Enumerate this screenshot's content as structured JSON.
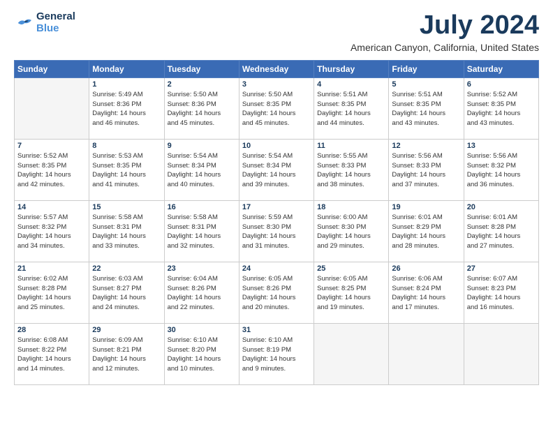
{
  "header": {
    "logo_line1": "General",
    "logo_line2": "Blue",
    "main_title": "July 2024",
    "subtitle": "American Canyon, California, United States"
  },
  "calendar": {
    "days_of_week": [
      "Sunday",
      "Monday",
      "Tuesday",
      "Wednesday",
      "Thursday",
      "Friday",
      "Saturday"
    ],
    "weeks": [
      [
        {
          "day": "",
          "info": ""
        },
        {
          "day": "1",
          "info": "Sunrise: 5:49 AM\nSunset: 8:36 PM\nDaylight: 14 hours\nand 46 minutes."
        },
        {
          "day": "2",
          "info": "Sunrise: 5:50 AM\nSunset: 8:36 PM\nDaylight: 14 hours\nand 45 minutes."
        },
        {
          "day": "3",
          "info": "Sunrise: 5:50 AM\nSunset: 8:35 PM\nDaylight: 14 hours\nand 45 minutes."
        },
        {
          "day": "4",
          "info": "Sunrise: 5:51 AM\nSunset: 8:35 PM\nDaylight: 14 hours\nand 44 minutes."
        },
        {
          "day": "5",
          "info": "Sunrise: 5:51 AM\nSunset: 8:35 PM\nDaylight: 14 hours\nand 43 minutes."
        },
        {
          "day": "6",
          "info": "Sunrise: 5:52 AM\nSunset: 8:35 PM\nDaylight: 14 hours\nand 43 minutes."
        }
      ],
      [
        {
          "day": "7",
          "info": "Sunrise: 5:52 AM\nSunset: 8:35 PM\nDaylight: 14 hours\nand 42 minutes."
        },
        {
          "day": "8",
          "info": "Sunrise: 5:53 AM\nSunset: 8:35 PM\nDaylight: 14 hours\nand 41 minutes."
        },
        {
          "day": "9",
          "info": "Sunrise: 5:54 AM\nSunset: 8:34 PM\nDaylight: 14 hours\nand 40 minutes."
        },
        {
          "day": "10",
          "info": "Sunrise: 5:54 AM\nSunset: 8:34 PM\nDaylight: 14 hours\nand 39 minutes."
        },
        {
          "day": "11",
          "info": "Sunrise: 5:55 AM\nSunset: 8:33 PM\nDaylight: 14 hours\nand 38 minutes."
        },
        {
          "day": "12",
          "info": "Sunrise: 5:56 AM\nSunset: 8:33 PM\nDaylight: 14 hours\nand 37 minutes."
        },
        {
          "day": "13",
          "info": "Sunrise: 5:56 AM\nSunset: 8:32 PM\nDaylight: 14 hours\nand 36 minutes."
        }
      ],
      [
        {
          "day": "14",
          "info": "Sunrise: 5:57 AM\nSunset: 8:32 PM\nDaylight: 14 hours\nand 34 minutes."
        },
        {
          "day": "15",
          "info": "Sunrise: 5:58 AM\nSunset: 8:31 PM\nDaylight: 14 hours\nand 33 minutes."
        },
        {
          "day": "16",
          "info": "Sunrise: 5:58 AM\nSunset: 8:31 PM\nDaylight: 14 hours\nand 32 minutes."
        },
        {
          "day": "17",
          "info": "Sunrise: 5:59 AM\nSunset: 8:30 PM\nDaylight: 14 hours\nand 31 minutes."
        },
        {
          "day": "18",
          "info": "Sunrise: 6:00 AM\nSunset: 8:30 PM\nDaylight: 14 hours\nand 29 minutes."
        },
        {
          "day": "19",
          "info": "Sunrise: 6:01 AM\nSunset: 8:29 PM\nDaylight: 14 hours\nand 28 minutes."
        },
        {
          "day": "20",
          "info": "Sunrise: 6:01 AM\nSunset: 8:28 PM\nDaylight: 14 hours\nand 27 minutes."
        }
      ],
      [
        {
          "day": "21",
          "info": "Sunrise: 6:02 AM\nSunset: 8:28 PM\nDaylight: 14 hours\nand 25 minutes."
        },
        {
          "day": "22",
          "info": "Sunrise: 6:03 AM\nSunset: 8:27 PM\nDaylight: 14 hours\nand 24 minutes."
        },
        {
          "day": "23",
          "info": "Sunrise: 6:04 AM\nSunset: 8:26 PM\nDaylight: 14 hours\nand 22 minutes."
        },
        {
          "day": "24",
          "info": "Sunrise: 6:05 AM\nSunset: 8:26 PM\nDaylight: 14 hours\nand 20 minutes."
        },
        {
          "day": "25",
          "info": "Sunrise: 6:05 AM\nSunset: 8:25 PM\nDaylight: 14 hours\nand 19 minutes."
        },
        {
          "day": "26",
          "info": "Sunrise: 6:06 AM\nSunset: 8:24 PM\nDaylight: 14 hours\nand 17 minutes."
        },
        {
          "day": "27",
          "info": "Sunrise: 6:07 AM\nSunset: 8:23 PM\nDaylight: 14 hours\nand 16 minutes."
        }
      ],
      [
        {
          "day": "28",
          "info": "Sunrise: 6:08 AM\nSunset: 8:22 PM\nDaylight: 14 hours\nand 14 minutes."
        },
        {
          "day": "29",
          "info": "Sunrise: 6:09 AM\nSunset: 8:21 PM\nDaylight: 14 hours\nand 12 minutes."
        },
        {
          "day": "30",
          "info": "Sunrise: 6:10 AM\nSunset: 8:20 PM\nDaylight: 14 hours\nand 10 minutes."
        },
        {
          "day": "31",
          "info": "Sunrise: 6:10 AM\nSunset: 8:19 PM\nDaylight: 14 hours\nand 9 minutes."
        },
        {
          "day": "",
          "info": ""
        },
        {
          "day": "",
          "info": ""
        },
        {
          "day": "",
          "info": ""
        }
      ]
    ]
  }
}
